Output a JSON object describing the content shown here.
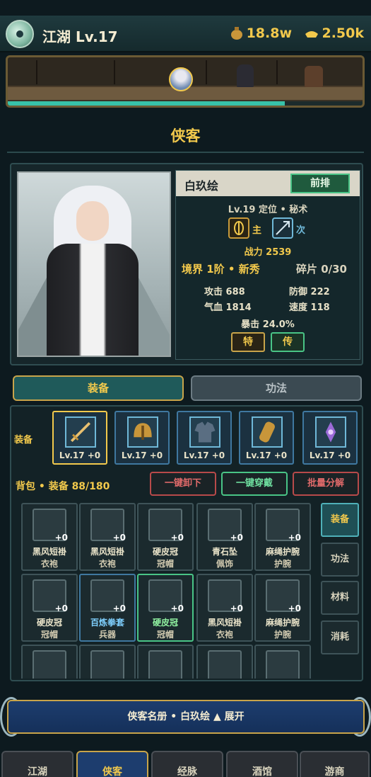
{
  "header": {
    "title": "江湖 Lv.17",
    "silver": "18.8w",
    "gold": "2.50k"
  },
  "battle": {
    "progress": 0.78
  },
  "section_title": "侠客",
  "hero": {
    "name": "白玖绘",
    "position_tag": "前排",
    "level_role": "Lv.19 定位 • 秘术",
    "primary_label": "主",
    "secondary_label": "次",
    "power": "战力 2539",
    "realm": "境界 1阶 • 新秀",
    "shards": "碎片 0/30",
    "stats": {
      "attack": "攻击 688",
      "defense": "防御 222",
      "hp": "气血 1814",
      "speed": "速度 118",
      "crit": "暴击 24.0%"
    },
    "trait_btn": "特",
    "legend_btn": "传"
  },
  "tabs": {
    "equip": "装备",
    "skill": "功法"
  },
  "equip_label": "装备",
  "slots": [
    {
      "lv": "Lv.17 +0",
      "icon": "sword-icon"
    },
    {
      "lv": "Lv.17 +0",
      "icon": "helmet-icon"
    },
    {
      "lv": "Lv.17 +0",
      "icon": "robe-icon"
    },
    {
      "lv": "Lv.17 +0",
      "icon": "bracer-icon"
    },
    {
      "lv": "Lv.17 +0",
      "icon": "amulet-icon"
    }
  ],
  "bag": {
    "title": "背包 • 装备 88/180",
    "unequip_all": "一键卸下",
    "equip_all": "一键穿戴",
    "batch_dismantle": "批量分解"
  },
  "bag_items": [
    {
      "n1": "黑风短褂",
      "n2": "衣袍",
      "plus": "+0",
      "rarity": "normal"
    },
    {
      "n1": "黑风短褂",
      "n2": "衣袍",
      "plus": "+0",
      "rarity": "normal"
    },
    {
      "n1": "硬皮冠",
      "n2": "冠帽",
      "plus": "+0",
      "rarity": "normal"
    },
    {
      "n1": "青石坠",
      "n2": "佩饰",
      "plus": "+0",
      "rarity": "normal"
    },
    {
      "n1": "麻绳护腕",
      "n2": "护腕",
      "plus": "+0",
      "rarity": "normal"
    },
    {
      "n1": "硬皮冠",
      "n2": "冠帽",
      "plus": "+0",
      "rarity": "normal"
    },
    {
      "n1": "百炼拳套",
      "n2": "兵器",
      "plus": "+0",
      "rarity": "blue"
    },
    {
      "n1": "硬皮冠",
      "n2": "冠帽",
      "plus": "+0",
      "rarity": "green"
    },
    {
      "n1": "黑风短褂",
      "n2": "衣袍",
      "plus": "+0",
      "rarity": "normal"
    },
    {
      "n1": "麻绳护腕",
      "n2": "护腕",
      "plus": "+0",
      "rarity": "normal"
    }
  ],
  "filters": [
    "装备",
    "功法",
    "材料",
    "消耗"
  ],
  "roster": "侠客名册 • 白玖绘 ▲ 展开",
  "nav": [
    "江湖",
    "侠客",
    "经脉",
    "酒馆",
    "游商"
  ]
}
